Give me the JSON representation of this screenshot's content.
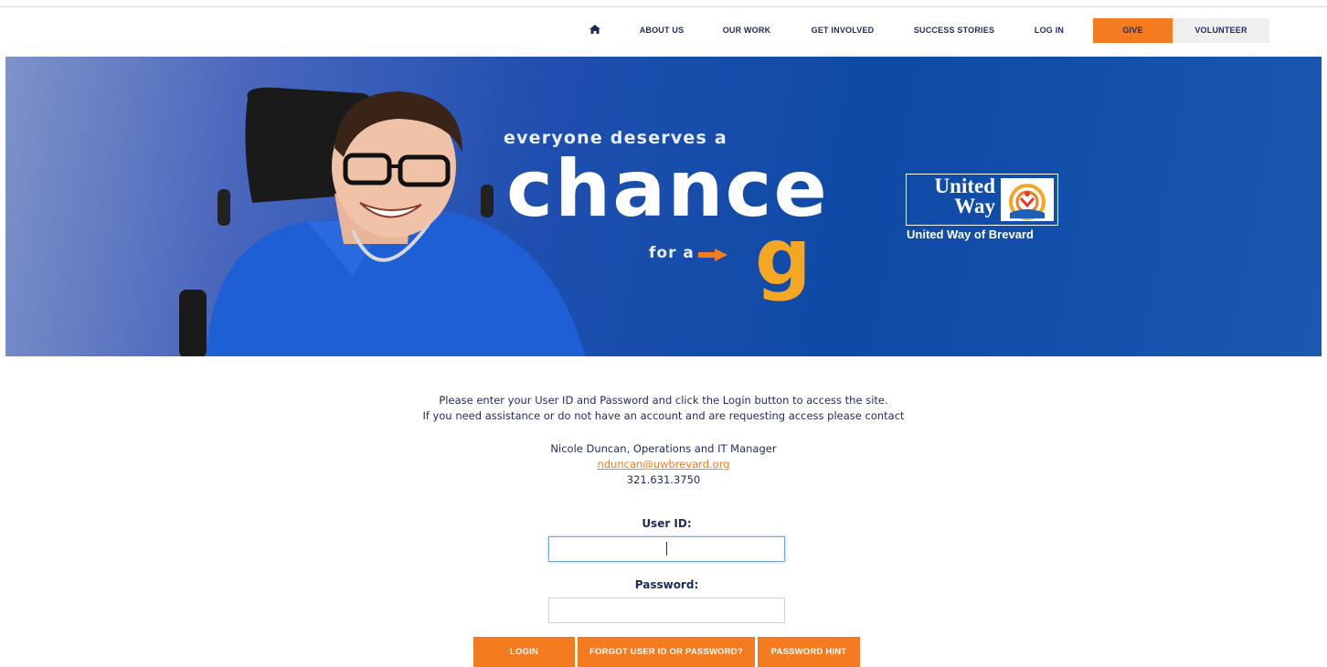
{
  "nav": {
    "home_icon": "home-icon",
    "items": [
      {
        "label": "ABOUT US"
      },
      {
        "label": "OUR WORK"
      },
      {
        "label": "GET INVOLVED"
      },
      {
        "label": "SUCCESS STORIES"
      },
      {
        "label": "LOG IN"
      }
    ],
    "give_label": "GIVE",
    "volunteer_label": "VOLUNTEER"
  },
  "hero": {
    "tagline_top": "everyone deserves a",
    "tagline_big": "chance",
    "tagline_for": "for a",
    "tagline_g": "g",
    "logo_line1": "United",
    "logo_line2": "Way",
    "logo_sub": "United Way of Brevard"
  },
  "intro": {
    "line1": "Please enter your User ID and Password and click the Login button to access the site.",
    "line2": "If you need assistance or do not have an account and are requesting access please contact"
  },
  "contact": {
    "name": "Nicole Duncan, Operations and IT Manager",
    "email": "nduncan@uwbrevard.org",
    "phone": "321.631.3750"
  },
  "form": {
    "user_label": "User ID:",
    "user_value": "",
    "password_label": "Password:",
    "password_value": ""
  },
  "buttons": {
    "login": "LOGIN",
    "forgot": "FORGOT USER ID OR PASSWORD?",
    "hint": "PASSWORD HINT"
  },
  "colors": {
    "accent": "#f47b20",
    "navy": "#1f2a5a",
    "hero_blue": "#0e4aa6",
    "gold": "#f5a623"
  }
}
